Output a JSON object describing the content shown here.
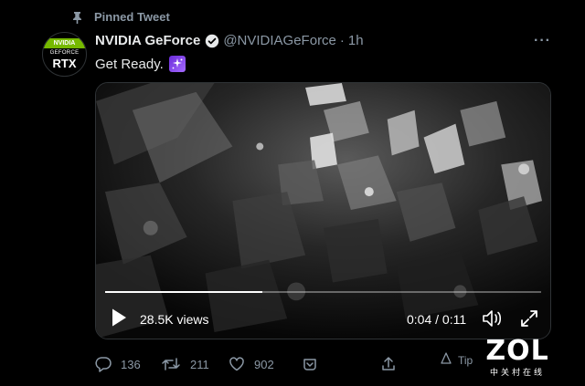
{
  "pinned": {
    "label": "Pinned Tweet",
    "icon": "pin-icon"
  },
  "author": {
    "name": "NVIDIA GeForce",
    "handle": "@NVIDIAGeForce",
    "separator": "·",
    "time": "1h",
    "avatar": {
      "brand": "NVIDIA",
      "line1": "GEFORCE",
      "line2": "RTX",
      "accent": "#76b900"
    }
  },
  "tweet": {
    "text": "Get Ready.",
    "emoji_icon": "sparkles-icon"
  },
  "video": {
    "views": "28.5K views",
    "time": "0:04 / 0:11",
    "progress": 0.36
  },
  "actions": {
    "reply_count": "136",
    "retweet_count": "211",
    "like_count": "902"
  },
  "tip": {
    "label": "Tip"
  },
  "watermark": {
    "logo": "ZOL",
    "sub": "中关村在线"
  },
  "colors": {
    "background": "#000000",
    "text_primary": "#e7e9ea",
    "text_secondary": "#8b98a5",
    "verified_badge": "#e7e9ea"
  }
}
